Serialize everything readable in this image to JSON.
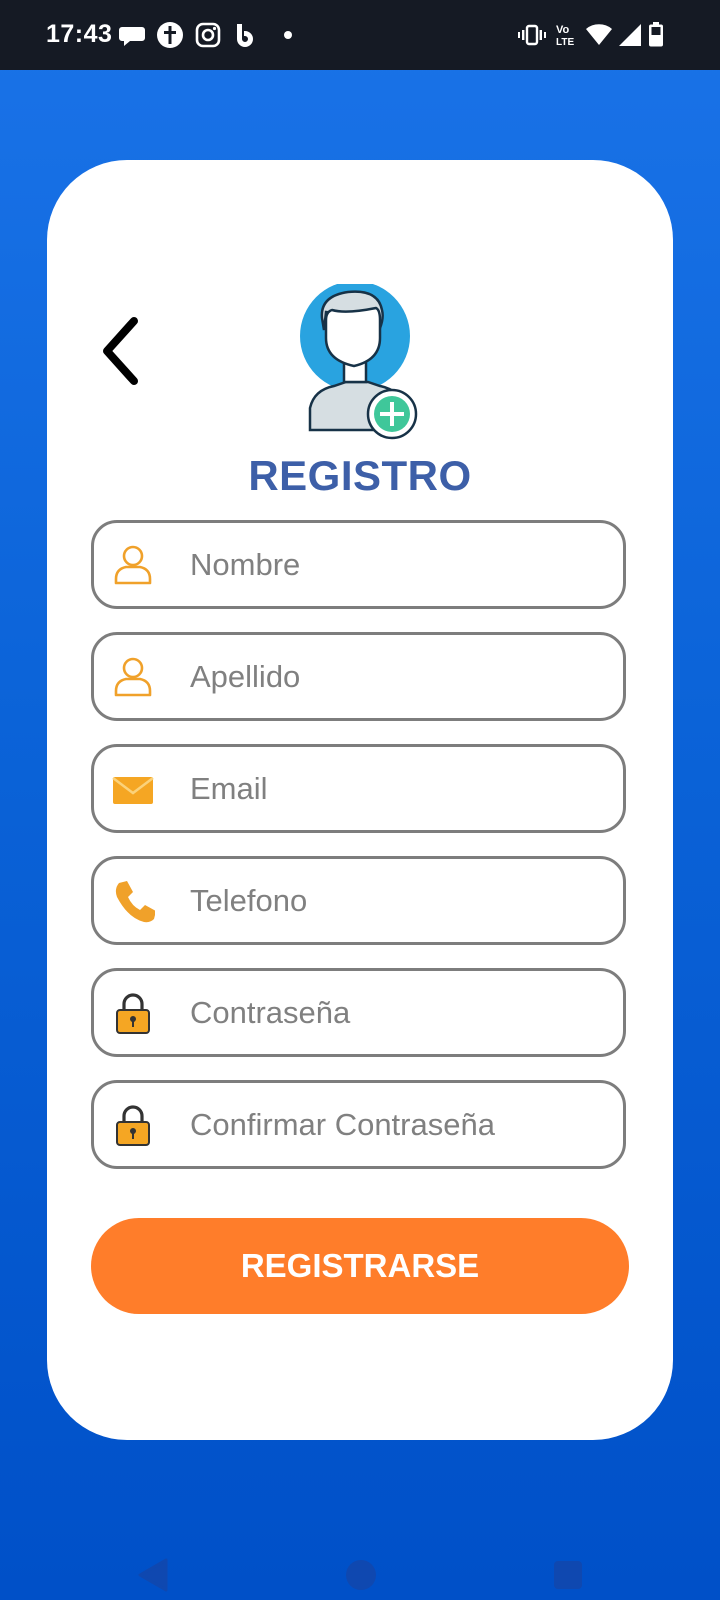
{
  "status_bar": {
    "time": "17:43",
    "notification_icons": [
      "chat-bubble-icon",
      "bible-app-icon",
      "instagram-icon",
      "b-app-icon",
      "more-dot-icon"
    ],
    "system_icons": [
      "vibrate-icon",
      "volte-icon",
      "wifi-icon",
      "signal-icon",
      "battery-icon"
    ],
    "volte_label": "Vo LTE"
  },
  "header": {
    "title": "REGISTRO",
    "back_icon": "chevron-left-icon",
    "avatar_icon": "add-user-avatar-icon"
  },
  "form": {
    "fields": [
      {
        "placeholder": "Nombre",
        "icon": "user-icon"
      },
      {
        "placeholder": "Apellido",
        "icon": "user-icon"
      },
      {
        "placeholder": "Email",
        "icon": "envelope-icon"
      },
      {
        "placeholder": "Telefono",
        "icon": "phone-icon"
      },
      {
        "placeholder": "Contraseña",
        "icon": "lock-icon"
      },
      {
        "placeholder": "Confirmar Contraseña",
        "icon": "lock-icon"
      }
    ],
    "submit_label": "REGISTRARSE"
  },
  "colors": {
    "background_top": "#1a73e8",
    "background_bottom": "#0050c8",
    "title": "#3d5fa8",
    "button": "#ff7d2a",
    "icon_orange": "#f0a12a",
    "avatar_circle": "#29a3e0",
    "plus_badge": "#3fc79a"
  },
  "nav_bar": {
    "items": [
      "nav-back-icon",
      "nav-home-icon",
      "nav-recents-icon"
    ]
  }
}
